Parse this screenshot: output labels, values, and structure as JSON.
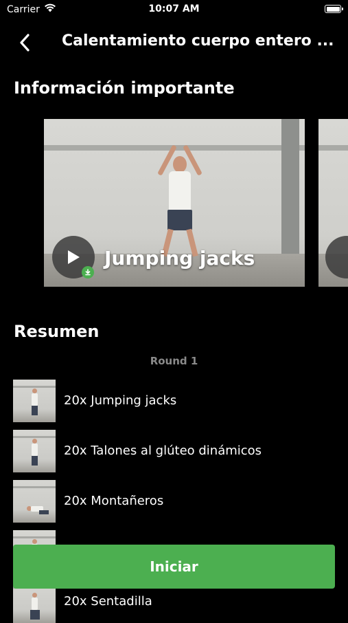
{
  "status_bar": {
    "carrier": "Carrier",
    "time": "10:07 AM"
  },
  "nav": {
    "title": "Calentamiento cuerpo entero ..."
  },
  "info_section": {
    "title": "Información importante"
  },
  "video": {
    "title": "Jumping jacks"
  },
  "summary": {
    "title": "Resumen",
    "round_label": "Round 1",
    "items": [
      {
        "label": "20x Jumping jacks"
      },
      {
        "label": "20x Talones al glúteo dinámicos"
      },
      {
        "label": "20x Montañeros"
      },
      {
        "label": ""
      },
      {
        "label": "20x Sentadilla"
      }
    ]
  },
  "actions": {
    "start_label": "Iniciar"
  },
  "colors": {
    "accent": "#4caf50",
    "background": "#000000",
    "muted_text": "#8a8a8a"
  }
}
